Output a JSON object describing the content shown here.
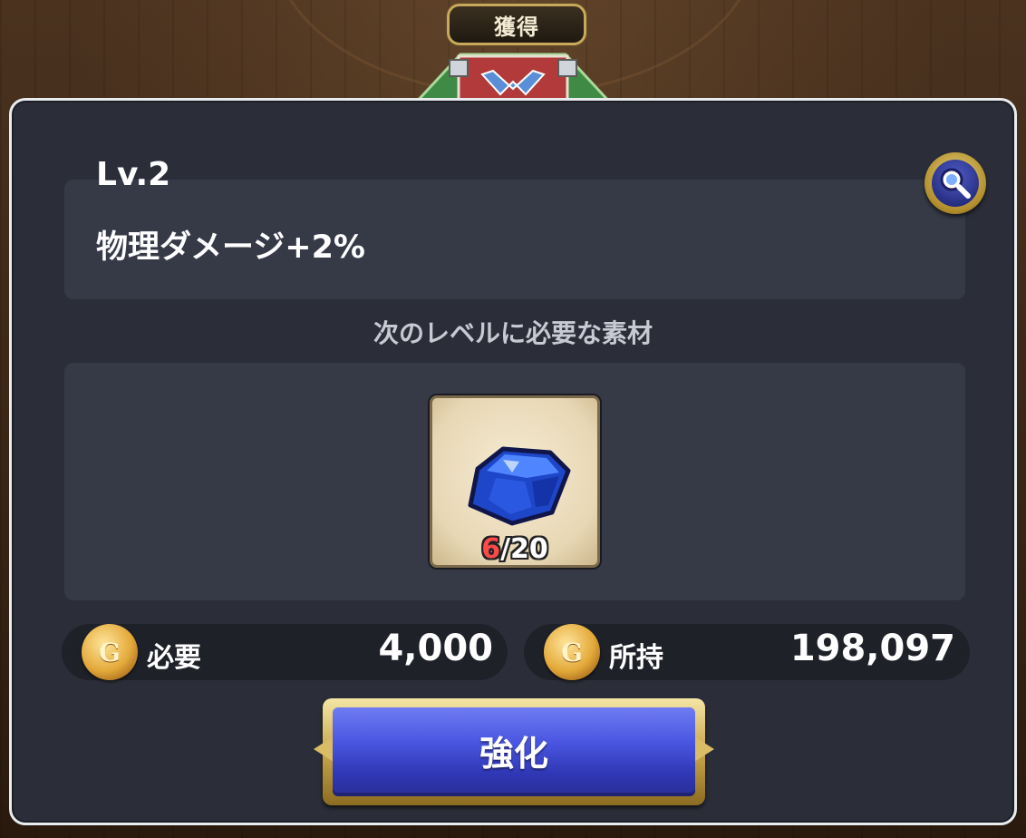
{
  "header": {
    "tab_label": "獲得"
  },
  "skill": {
    "level": "Lv.2",
    "effect": "物理ダメージ+2%"
  },
  "materials": {
    "section_title": "次のレベルに必要な素材",
    "item": {
      "icon": "blue-crystal-icon",
      "owned": "6",
      "separator": "/",
      "required": "20"
    }
  },
  "cost": {
    "required_label": "必要",
    "required_value": "4,000",
    "owned_label": "所持",
    "owned_value": "198,097",
    "coin_symbol": "G"
  },
  "actions": {
    "enhance_label": "強化"
  },
  "colors": {
    "button_blue": "#4a55e0",
    "gold": "#c9a64b",
    "panel": "#2b2e39",
    "insufficient_red": "#ff4a4a"
  }
}
